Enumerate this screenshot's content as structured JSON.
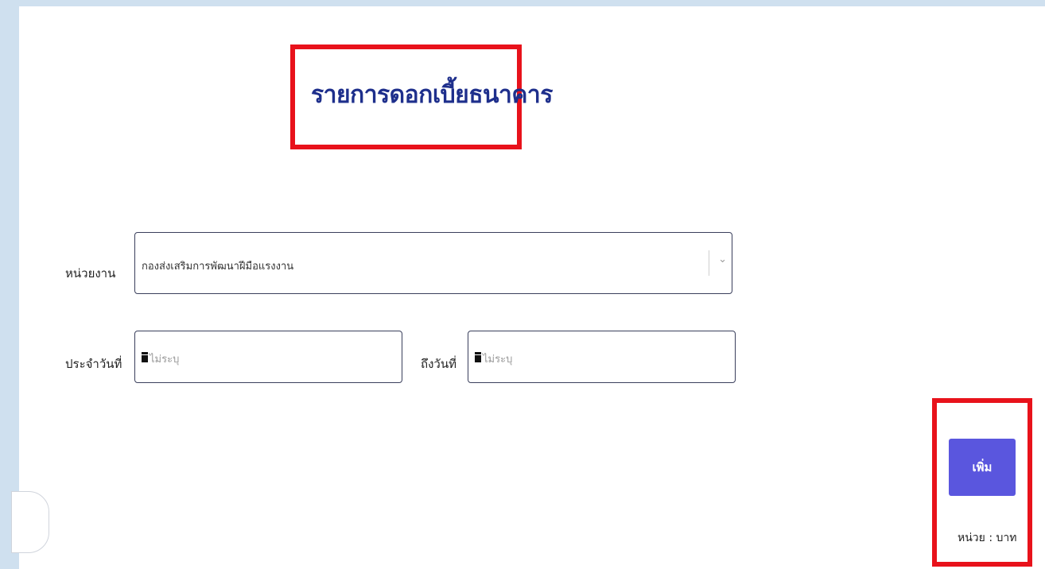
{
  "page": {
    "title": "รายการดอกเบี้ยธนาคาร"
  },
  "form": {
    "agency_label": "หน่วยงาน",
    "agency_value": "กองส่งเสริมการพัฒนาฝีมือแรงงาน",
    "from_date_label": "ประจำวันที่",
    "from_date_placeholder": "ไม่ระบุ",
    "to_date_label": "ถึงวันที่",
    "to_date_placeholder": "ไม่ระบุ"
  },
  "actions": {
    "add_label": "เพิ่ม"
  },
  "footer": {
    "unit_text": "หน่วย : บาท"
  },
  "colors": {
    "title": "#1e2f8c",
    "highlight": "#e8121b",
    "button": "#5a56de",
    "background": "#cfe0ef"
  },
  "icons": {
    "date": "calendar-icon",
    "dropdown": "chevron-down-icon"
  }
}
